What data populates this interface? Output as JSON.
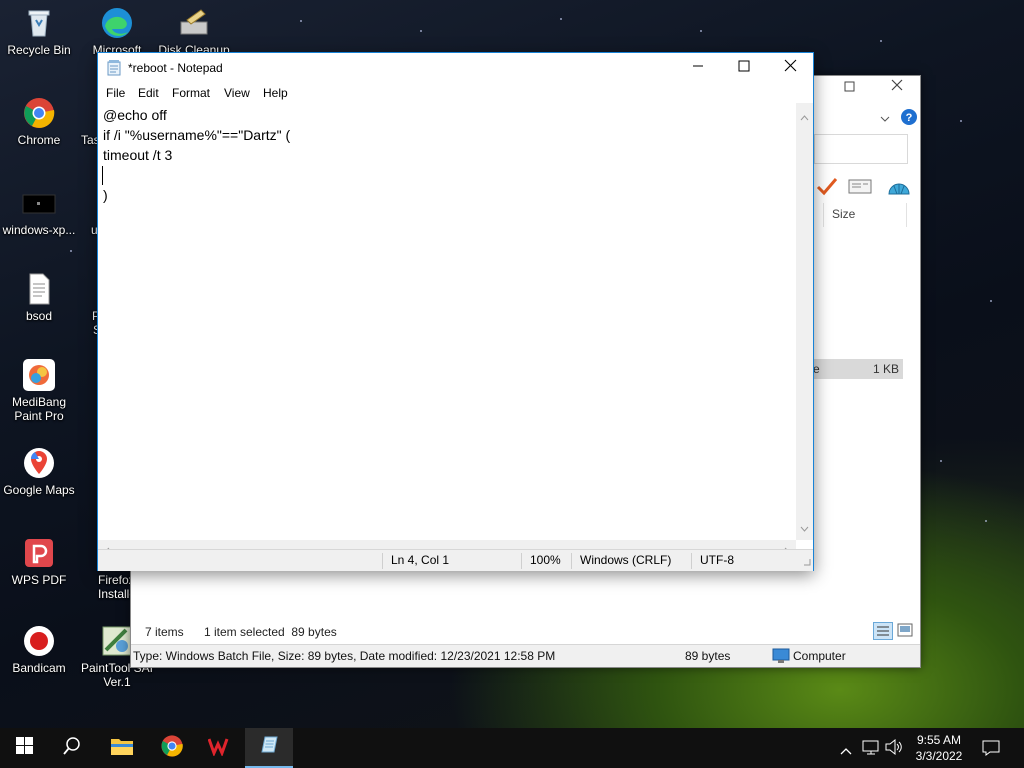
{
  "desktop": {
    "icons": [
      {
        "label": "Recycle Bin"
      },
      {
        "label": "Microsoft"
      },
      {
        "label": "Disk Cleanup"
      },
      {
        "label": "Chrome"
      },
      {
        "label": "Tas"
      },
      {
        "label": "windows-xp..."
      },
      {
        "label": "u"
      },
      {
        "label": "bsod"
      },
      {
        "label": "P"
      },
      {
        "label": "S"
      },
      {
        "label": "MediBang Paint Pro"
      },
      {
        "label": "Google Maps"
      },
      {
        "label": "WPS PDF"
      },
      {
        "label": "Firefox Installer"
      },
      {
        "label": "Bandicam"
      },
      {
        "label": "PaintTool SAI Ver.1"
      }
    ]
  },
  "explorer": {
    "column_size": "Size",
    "row_size": "1 KB",
    "row_partial": "e",
    "items_count": "7 items",
    "selected": "1 item selected  89 bytes",
    "details_type": "Type: Windows Batch File, Size: 89 bytes, Date modified: 12/23/2021 12:58 PM",
    "details_size": "89 bytes",
    "details_location": "Computer"
  },
  "notepad": {
    "title": "*reboot - Notepad",
    "menu": [
      "File",
      "Edit",
      "Format",
      "View",
      "Help"
    ],
    "lines": [
      "@echo off",
      "if /i \"%username%\"==\"Dartz\" (",
      "timeout /t 3",
      "",
      ")"
    ],
    "status": {
      "position": "Ln 4, Col 1",
      "zoom": "100%",
      "line_ending": "Windows (CRLF)",
      "encoding": "UTF-8"
    }
  },
  "taskbar": {
    "time": "9:55 AM",
    "date": "3/3/2022"
  },
  "colors": {
    "accent": "#1883d7",
    "taskbar": "#101010",
    "active_indicator": "#76b9ed"
  }
}
